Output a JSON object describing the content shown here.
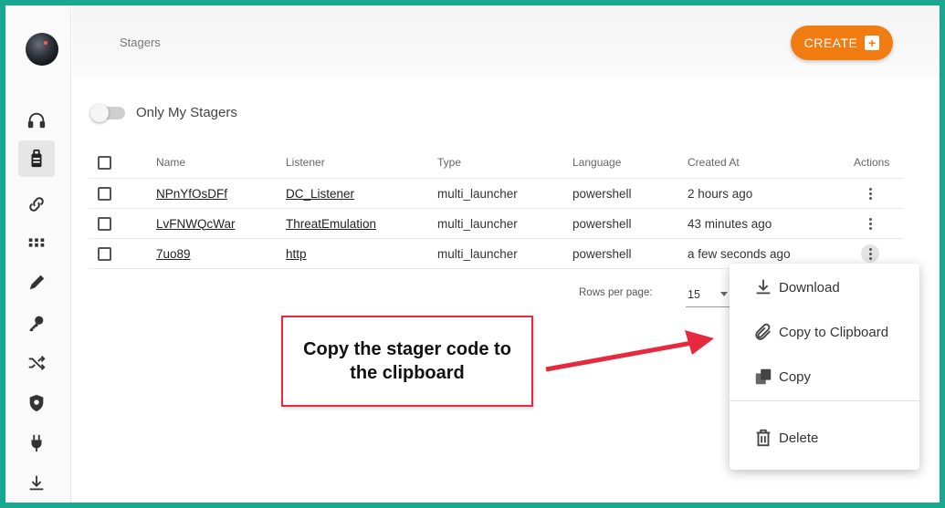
{
  "header": {
    "breadcrumb": "Stagers",
    "create_label": "CREATE",
    "create_icon": "plus-box-icon"
  },
  "filter": {
    "only_my_label": "Only My Stagers",
    "only_my_enabled": false
  },
  "sidebar": {
    "items": [
      {
        "icon": "headphones-icon"
      },
      {
        "icon": "briefcase-icon",
        "active": true
      },
      {
        "icon": "link-icon"
      },
      {
        "icon": "grid-icon"
      },
      {
        "icon": "pencil-icon"
      },
      {
        "icon": "key-icon"
      },
      {
        "icon": "shuffle-icon"
      },
      {
        "icon": "shield-icon"
      },
      {
        "icon": "plug-icon"
      },
      {
        "icon": "download-icon"
      }
    ]
  },
  "table": {
    "headers": {
      "name": "Name",
      "listener": "Listener",
      "type": "Type",
      "language": "Language",
      "created": "Created At",
      "actions": "Actions"
    },
    "rows": [
      {
        "name": "NPnYfOsDFf",
        "listener": "DC_Listener",
        "type": "multi_launcher",
        "language": "powershell",
        "created": "2 hours ago"
      },
      {
        "name": "LvFNWQcWar",
        "listener": "ThreatEmulation",
        "type": "multi_launcher",
        "language": "powershell",
        "created": "43 minutes ago"
      },
      {
        "name": "7uo89",
        "listener": "http",
        "type": "multi_launcher",
        "language": "powershell",
        "created": "a few seconds ago"
      }
    ]
  },
  "pagination": {
    "rows_per_page_label": "Rows per page:",
    "rows_per_page_value": "15"
  },
  "menu": {
    "download": "Download",
    "copy_to_clipboard": "Copy to Clipboard",
    "copy": "Copy",
    "delete": "Delete"
  },
  "callout": {
    "text": "Copy the stager code to the clipboard"
  },
  "colors": {
    "frame": "#19a88e",
    "accent": "#f07c12",
    "callout_border": "#e6293d"
  }
}
